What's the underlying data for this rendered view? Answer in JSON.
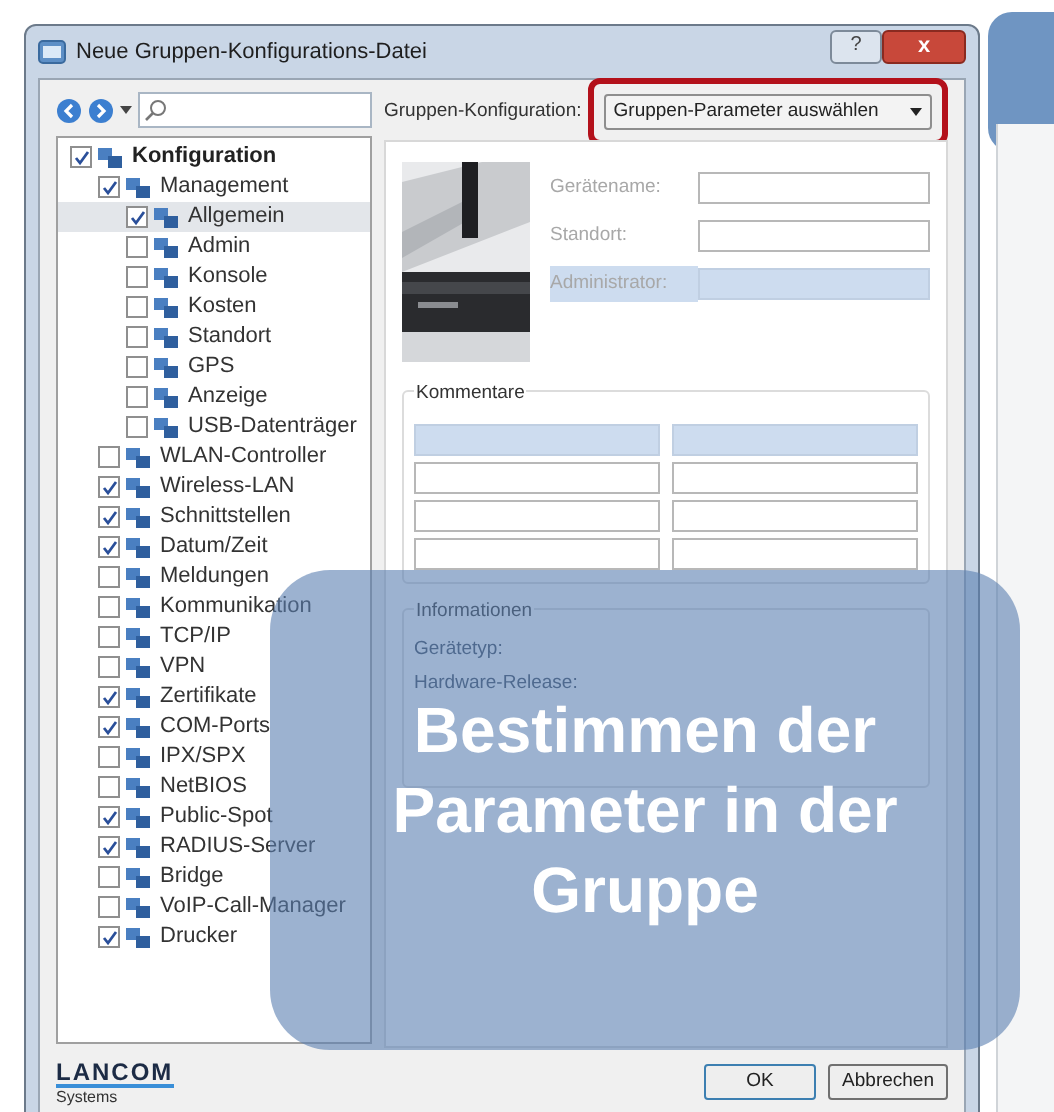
{
  "window": {
    "title": "Neue Gruppen-Konfigurations-Datei",
    "help": "?",
    "close": "x"
  },
  "group_config": {
    "label": "Gruppen-Konfiguration:",
    "value": "Gruppen-Parameter auswählen",
    "highlighted": true
  },
  "tree": [
    {
      "label": "Konfiguration",
      "checked": true,
      "selected": false,
      "children": [
        {
          "label": "Management",
          "checked": true,
          "selected": false,
          "children": [
            {
              "label": "Allgemein",
              "checked": true,
              "selected": true
            },
            {
              "label": "Admin",
              "checked": false,
              "selected": false
            },
            {
              "label": "Konsole",
              "checked": false,
              "selected": false
            },
            {
              "label": "Kosten",
              "checked": false,
              "selected": false
            },
            {
              "label": "Standort",
              "checked": false,
              "selected": false
            },
            {
              "label": "GPS",
              "checked": false,
              "selected": false
            },
            {
              "label": "Anzeige",
              "checked": false,
              "selected": false
            },
            {
              "label": "USB-Datenträger",
              "checked": false,
              "selected": false
            }
          ]
        },
        {
          "label": "WLAN-Controller",
          "checked": false,
          "selected": false
        },
        {
          "label": "Wireless-LAN",
          "checked": true,
          "selected": false
        },
        {
          "label": "Schnittstellen",
          "checked": true,
          "selected": false
        },
        {
          "label": "Datum/Zeit",
          "checked": true,
          "selected": false
        },
        {
          "label": "Meldungen",
          "checked": false,
          "selected": false
        },
        {
          "label": "Kommunikation",
          "checked": false,
          "selected": false
        },
        {
          "label": "TCP/IP",
          "checked": false,
          "selected": false
        },
        {
          "label": "VPN",
          "checked": false,
          "selected": false
        },
        {
          "label": "Zertifikate",
          "checked": true,
          "selected": false
        },
        {
          "label": "COM-Ports",
          "checked": true,
          "selected": false
        },
        {
          "label": "IPX/SPX",
          "checked": false,
          "selected": false
        },
        {
          "label": "NetBIOS",
          "checked": false,
          "selected": false
        },
        {
          "label": "Public-Spot",
          "checked": true,
          "selected": false
        },
        {
          "label": "RADIUS-Server",
          "checked": true,
          "selected": false
        },
        {
          "label": "Bridge",
          "checked": false,
          "selected": false
        },
        {
          "label": "VoIP-Call-Manager",
          "checked": false,
          "selected": false
        },
        {
          "label": "Drucker",
          "checked": true,
          "selected": false
        }
      ]
    }
  ],
  "device": {
    "fields": [
      {
        "label": "Gerätename:",
        "selected": false
      },
      {
        "label": "Standort:",
        "selected": false
      },
      {
        "label": "Administrator:",
        "selected": true
      }
    ]
  },
  "comments": {
    "title": "Kommentare",
    "rows": [
      {
        "selected": true
      },
      {
        "selected": false
      },
      {
        "selected": false
      },
      {
        "selected": false
      }
    ]
  },
  "info": {
    "title": "Informationen",
    "labels": [
      "Gerätetyp:",
      "Hardware-Release:"
    ]
  },
  "logo": {
    "name": "LANCOM",
    "tagline": "Systems"
  },
  "buttons": [
    {
      "label": "OK",
      "default": true
    },
    {
      "label": "Abbrechen",
      "default": false
    }
  ],
  "overlay": {
    "text": "Bestimmen der Parameter in der Gruppe"
  }
}
